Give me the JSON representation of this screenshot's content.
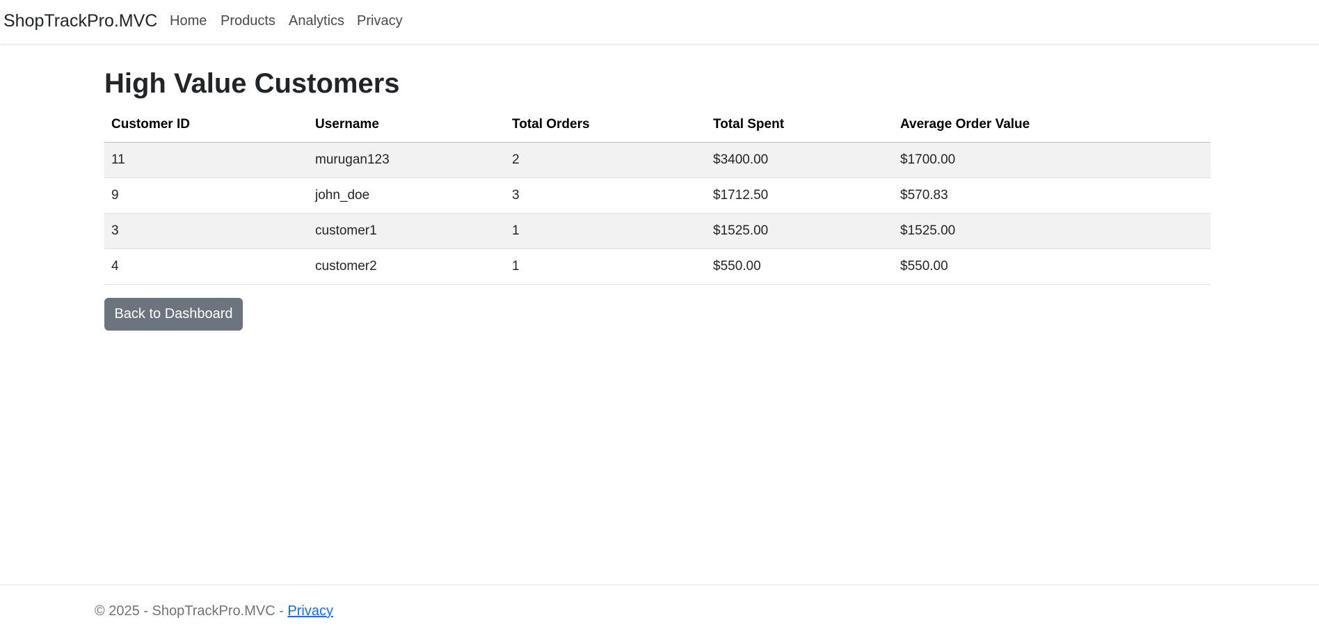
{
  "navbar": {
    "brand": "ShopTrackPro.MVC",
    "links": [
      "Home",
      "Products",
      "Analytics",
      "Privacy"
    ]
  },
  "page": {
    "title": "High Value Customers"
  },
  "table": {
    "headers": [
      "Customer ID",
      "Username",
      "Total Orders",
      "Total Spent",
      "Average Order Value"
    ],
    "rows": [
      [
        "11",
        "murugan123",
        "2",
        "$3400.00",
        "$1700.00"
      ],
      [
        "9",
        "john_doe",
        "3",
        "$1712.50",
        "$570.83"
      ],
      [
        "3",
        "customer1",
        "1",
        "$1525.00",
        "$1525.00"
      ],
      [
        "4",
        "customer2",
        "1",
        "$550.00",
        "$550.00"
      ]
    ]
  },
  "actions": {
    "back_label": "Back to Dashboard"
  },
  "footer": {
    "text": "© 2025 - ShopTrackPro.MVC - ",
    "link": "Privacy"
  },
  "colors": {
    "button_bg": "#6c757d",
    "link": "#0d6efd",
    "striped_row": "#f2f2f2"
  }
}
